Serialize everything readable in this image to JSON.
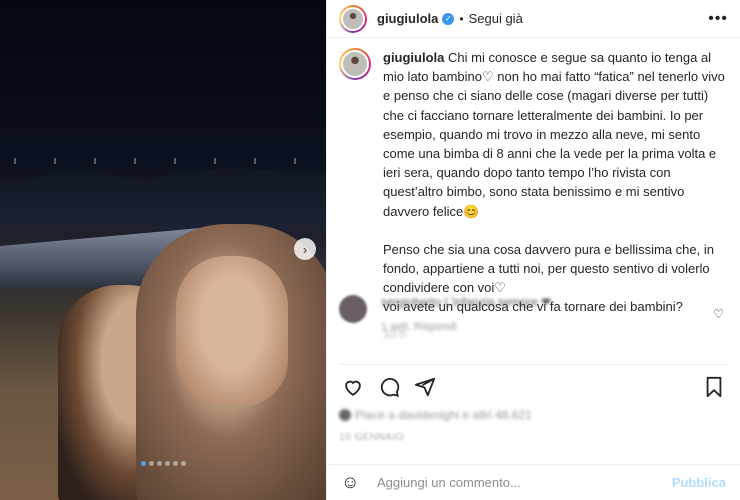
{
  "post": {
    "username": "giugiulola",
    "verified_mark": "✓",
    "follow_separator": "•",
    "follow_label": "Segui già",
    "more_label": "•••"
  },
  "caption": {
    "username": "giugiulola",
    "p1": "Chi mi conosce e segue sa quanto io tenga al mio lato bambino♡ non ho mai fatto “fatica” nel tenerlo vivo e penso che ci siano delle cose (magari diverse per tutti) che ci facciano tornare letteralmente dei bambini. Io per esempio, quando mi trovo in mezzo alla neve, mi sento come una bimba di 8 anni che la vede per la prima volta e ieri sera, quando dopo tanto tempo l’ho rivista con quest’altro bimbo, sono stata benissimo e mi sentivo davvero felice😊",
    "p2": "Penso che sia una cosa davvero pura e bellissima che, in fondo, appartiene a tutti noi, per questo sentivo di volerlo condividere con voi♡",
    "p3": "voi avete un qualcosa che vi fa tornare dei bambini?",
    "time_blurred": "10 h"
  },
  "comment": {
    "text": "sergioberto  L’infanzia sempre ❤",
    "meta": "1 sett.    Rispondi",
    "heart": "♡"
  },
  "carousel": {
    "next_arrow": "›",
    "dots": 6,
    "active_index": 0
  },
  "actions": {
    "icons": [
      "heart-icon",
      "comment-icon",
      "share-icon",
      "bookmark-icon"
    ]
  },
  "likes": {
    "text": "Piace a davidenighi e altri 48.621"
  },
  "date": {
    "text": "10 GENNAIO"
  },
  "add_comment": {
    "emoji": "☺",
    "placeholder": "Aggiungi un commento...",
    "publish_label": "Pubblica"
  }
}
